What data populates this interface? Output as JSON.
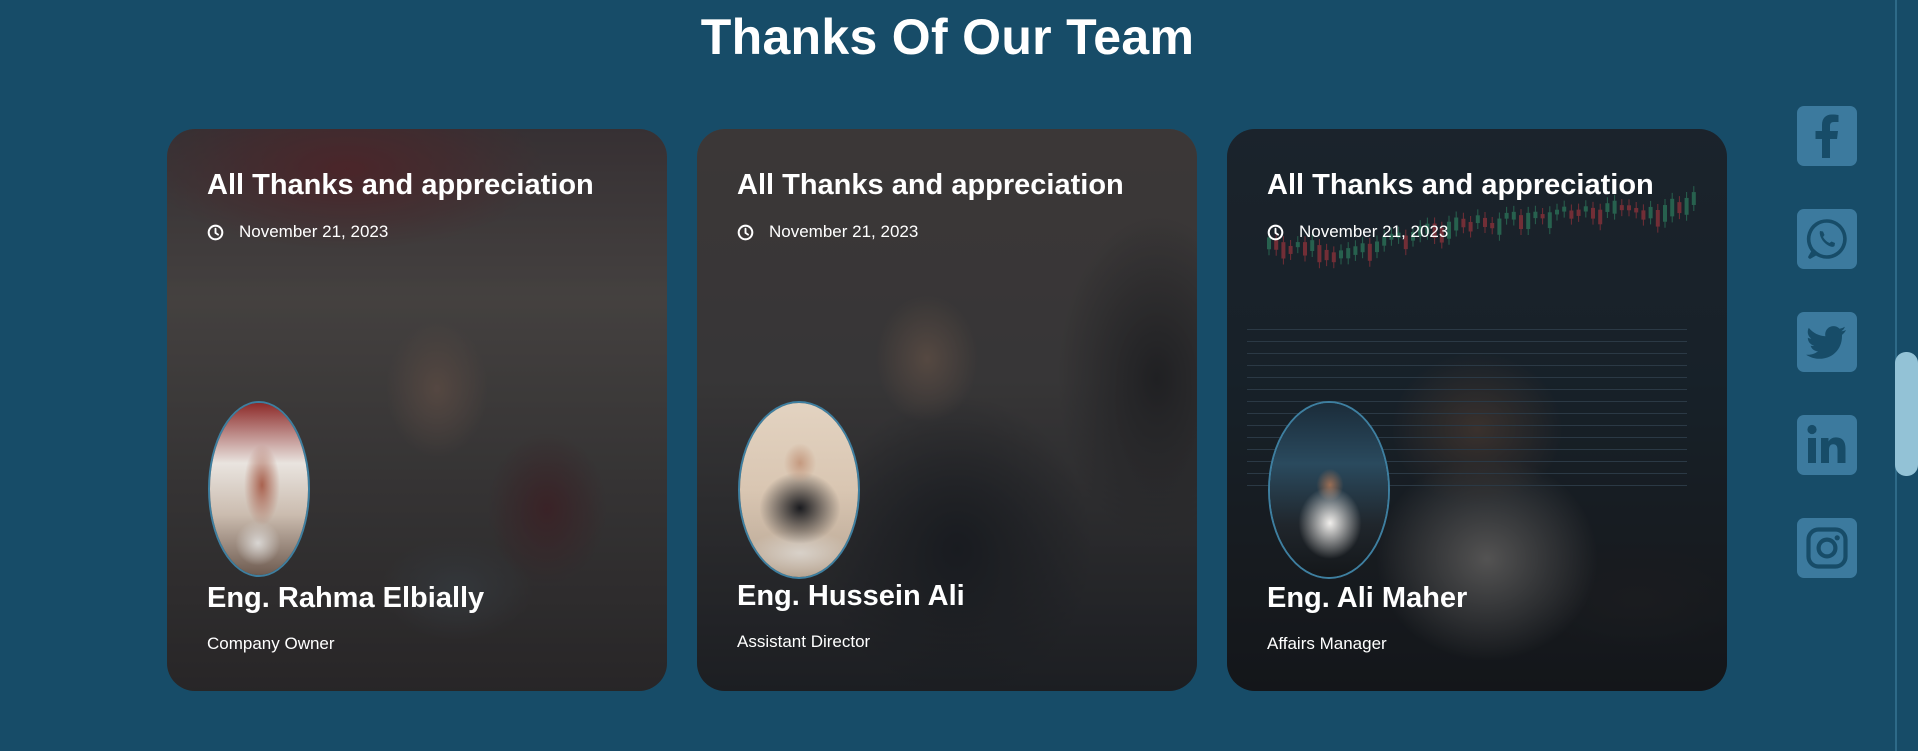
{
  "section": {
    "title": "Thanks Of Our Team"
  },
  "cards": [
    {
      "title": "All Thanks and appreciation",
      "date": "November 21, 2023",
      "name": "Eng. Rahma Elbially",
      "role": "Company Owner"
    },
    {
      "title": "All Thanks and appreciation",
      "date": "November 21, 2023",
      "name": "Eng. Hussein Ali",
      "role": "Assistant Director"
    },
    {
      "title": "All Thanks and appreciation",
      "date": "November 21, 2023",
      "name": "Eng. Ali Maher",
      "role": "Affairs Manager"
    }
  ],
  "social": [
    {
      "icon": "facebook-icon"
    },
    {
      "icon": "whatsapp-icon"
    },
    {
      "icon": "twitter-icon"
    },
    {
      "icon": "linkedin-icon"
    },
    {
      "icon": "instagram-icon"
    }
  ],
  "colors": {
    "background": "#174c68",
    "social_button": "#3c7a9e",
    "social_glyph": "#174c68",
    "scroll_thumb": "#93c2d6"
  }
}
